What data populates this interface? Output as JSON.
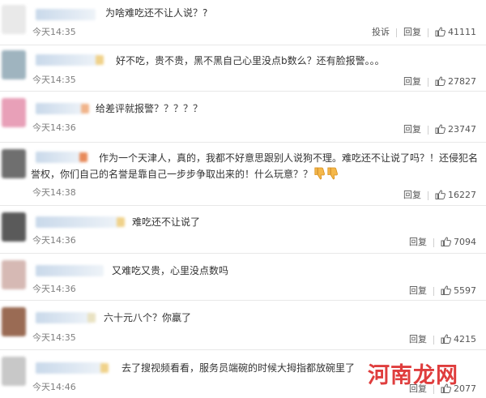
{
  "comments": [
    {
      "text": "为啥难吃还不让人说？?",
      "time": "今天14:35",
      "has_report": true,
      "report_label": "投诉",
      "reply_label": "回复",
      "likes": "41111",
      "avatar_color": "#e9e9e9"
    },
    {
      "text": "好不吃，贵不贵，黑不黑自己心里没点b数么？还有脸报警。。。",
      "time": "今天14:35",
      "has_report": false,
      "reply_label": "回复",
      "likes": "27827",
      "avatar_color": "#9fb4bf"
    },
    {
      "text": "给差评就报警？？？？？",
      "time": "今天14:36",
      "has_report": false,
      "reply_label": "回复",
      "likes": "23747",
      "avatar_color": "#e8a0b8"
    },
    {
      "text": "作为一个天津人，真的，我都不好意思跟别人说狗不理。难吃还不让说了吗？！还侵犯名誉权，你们自己的名誉是靠自己一步步争取出来的！什么玩意？？",
      "time": "今天14:38",
      "has_report": false,
      "reply_label": "回复",
      "likes": "16227",
      "avatar_color": "#6f6f6f",
      "emoji": [
        "thumbs-down-icon",
        "thumbs-down-icon"
      ]
    },
    {
      "text": "难吃还不让说了",
      "time": "今天14:36",
      "has_report": false,
      "reply_label": "回复",
      "likes": "7094",
      "avatar_color": "#5a5a5a"
    },
    {
      "text": "又难吃又贵，心里没点数吗",
      "time": "今天14:36",
      "has_report": false,
      "reply_label": "回复",
      "likes": "5597",
      "avatar_color": "#d6b9b4"
    },
    {
      "text": "六十元八个？你羸了",
      "time": "今天14:35",
      "has_report": false,
      "reply_label": "回复",
      "likes": "4215",
      "avatar_color": "#9a6b54"
    },
    {
      "text": "去了搜视频看看，服务员端碗的时候大拇指都放碗里了",
      "time": "今天14:46",
      "has_report": false,
      "reply_label": "回复",
      "likes": "2077",
      "avatar_color": "#c8c8c8"
    }
  ],
  "watermark": "河南龙网",
  "colors": {
    "text": "#333333",
    "time": "#808080",
    "divider": "#e8e8e8",
    "watermark": "#dc2828"
  }
}
